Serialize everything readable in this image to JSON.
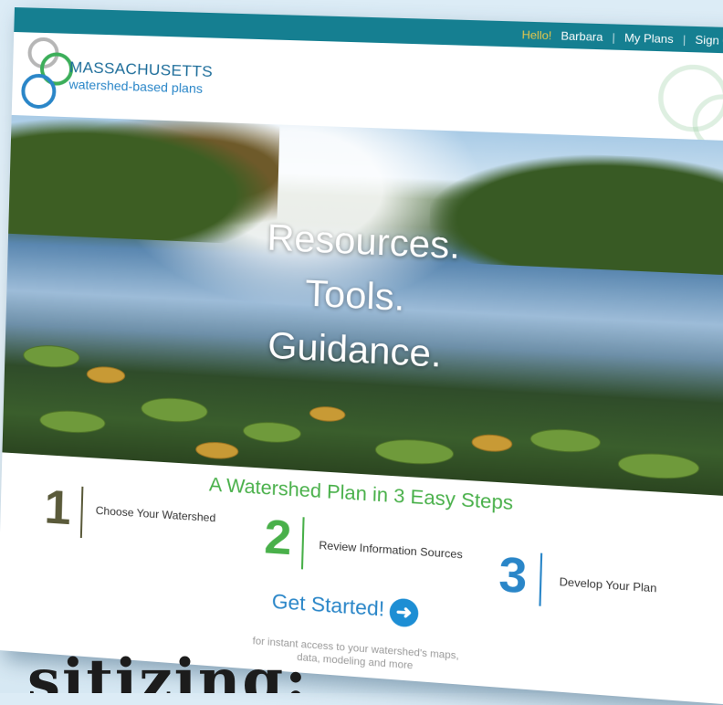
{
  "topbar": {
    "greeting": "Hello!",
    "user_name": "Barbara",
    "my_plans": "My Plans",
    "sign_out": "Sign Out"
  },
  "logo": {
    "title": "MASSACHUSETTS",
    "subtitle": "watershed-based plans"
  },
  "hero": {
    "line1": "Resources.",
    "line2": "Tools.",
    "line3": "Guidance."
  },
  "steps": {
    "headline": "A Watershed Plan in 3 Easy Steps",
    "items": [
      {
        "number": "1",
        "label": "Choose Your Watershed",
        "color": "#5a5a3a"
      },
      {
        "number": "2",
        "label": "Review Information Sources",
        "color": "#49b04a"
      },
      {
        "number": "3",
        "label": "Develop Your Plan",
        "color": "#2a86c8"
      }
    ]
  },
  "cta": {
    "label": "Get Started!",
    "icon": "arrow-right-circle-icon",
    "subtext": "for instant access to your watershed's maps, data, modeling and more"
  },
  "overlay_caption": "sitizing:",
  "colors": {
    "topbar": "#157f91",
    "accent_green": "#49b04a",
    "accent_blue": "#2a86c8",
    "greeting": "#e9c84a"
  }
}
